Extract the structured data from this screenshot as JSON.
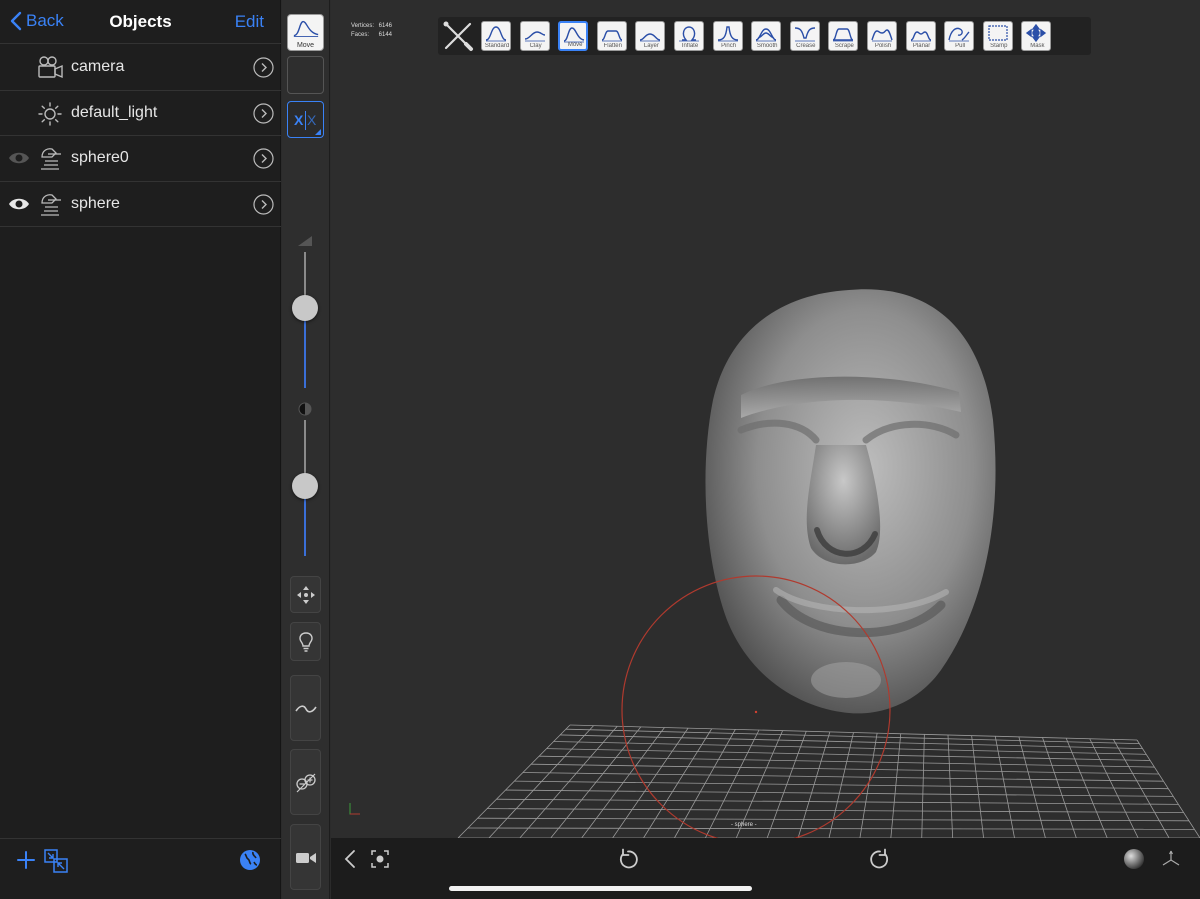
{
  "panel": {
    "back_label": "Back",
    "title": "Objects",
    "edit_label": "Edit",
    "objects": [
      {
        "name": "camera",
        "type": "camera",
        "visible": null
      },
      {
        "name": "default_light",
        "type": "light",
        "visible": null
      },
      {
        "name": "sphere0",
        "type": "mesh",
        "visible": "dim"
      },
      {
        "name": "sphere",
        "type": "mesh",
        "visible": "on"
      }
    ]
  },
  "toolstrip": {
    "current_tool_label": "Move",
    "symmetry_x_label": "X",
    "radius_level": 0.38,
    "intensity_level": 0.46
  },
  "viewport": {
    "stats": {
      "vertices_label": "Vertices:",
      "vertices_value": "6146",
      "faces_label": "Faces:",
      "faces_value": "6144"
    },
    "selected_object_label": "- sphere -",
    "brushes": [
      {
        "label": "Standard",
        "icon": "standard-brush-icon"
      },
      {
        "label": "Clay",
        "icon": "clay-brush-icon"
      },
      {
        "label": "Move",
        "icon": "move-brush-icon",
        "active": true
      },
      {
        "label": "Flatten",
        "icon": "flatten-brush-icon"
      },
      {
        "label": "Layer",
        "icon": "layer-brush-icon"
      },
      {
        "label": "Inflate",
        "icon": "inflate-brush-icon"
      },
      {
        "label": "Pinch",
        "icon": "pinch-brush-icon"
      },
      {
        "label": "Smooth",
        "icon": "smooth-brush-icon"
      },
      {
        "label": "Crease",
        "icon": "crease-brush-icon"
      },
      {
        "label": "Scrape",
        "icon": "scrape-brush-icon"
      },
      {
        "label": "Polish",
        "icon": "polish-brush-icon"
      },
      {
        "label": "Planar",
        "icon": "planar-brush-icon"
      },
      {
        "label": "Pull",
        "icon": "pull-brush-icon"
      },
      {
        "label": "Stamp",
        "icon": "stamp-brush-icon"
      },
      {
        "label": "Mask",
        "icon": "mask-brush-icon"
      }
    ]
  },
  "colors": {
    "accent": "#3a82f6",
    "panel_bg": "#1e1e1e",
    "viewport_bg": "#2d2d2d",
    "brush_circle": "#b03a2e",
    "grid": "#9a9a9a"
  }
}
